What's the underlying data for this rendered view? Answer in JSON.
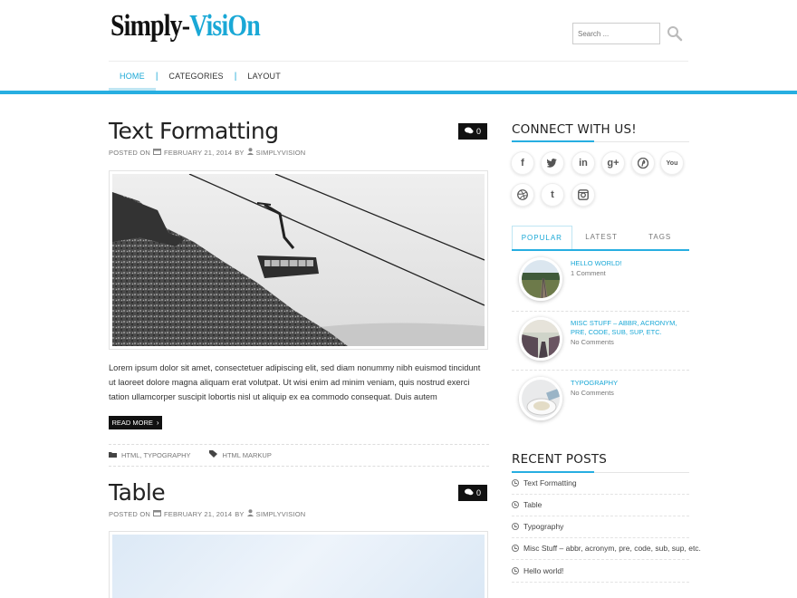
{
  "brand": {
    "part1": "Simply-",
    "part2": "VisiOn"
  },
  "search": {
    "placeholder": "Search ..."
  },
  "nav": {
    "items": [
      "HOME",
      "CATEGORIES",
      "LAYOUT"
    ],
    "separator": "|"
  },
  "colors": {
    "accent": "#27aee1",
    "link": "#1aa8d6",
    "dark": "#111111"
  },
  "posts": [
    {
      "title": "Text Formatting",
      "posted_on": "POSTED ON",
      "date": "FEBRUARY 21, 2014",
      "by": "BY",
      "author": "SIMPLYVISION",
      "comments": "0",
      "excerpt": "Lorem ipsum dolor sit amet, consectetuer adipiscing elit, sed diam nonummy nibh euismod tincidunt ut laoreet dolore magna aliquam erat volutpat. Ut wisi enim ad minim veniam, quis nostrud exerci tation ullamcorper suscipit lobortis nisl ut aliquip ex ea commodo consequat. Duis autem",
      "read_more": "READ MORE",
      "categories": "HTML, TYPOGRAPHY",
      "tags": "HTML MARKUP"
    },
    {
      "title": "Table",
      "posted_on": "POSTED ON",
      "date": "FEBRUARY 21, 2014",
      "by": "BY",
      "author": "SIMPLYVISION",
      "comments": "0"
    }
  ],
  "sidebar": {
    "connect_title": "CONNECT WITH US!",
    "social_icons": [
      "facebook-icon",
      "twitter-icon",
      "linkedin-icon",
      "google-plus-icon",
      "pinterest-icon",
      "youtube-icon",
      "dribbble-icon",
      "tumblr-icon",
      "instagram-icon"
    ],
    "social_glyphs": [
      "f",
      "🐦",
      "in",
      "g+",
      "℗",
      "You",
      "◎",
      "t",
      "▣"
    ],
    "tabs": [
      "POPULAR",
      "LATEST",
      "TAGS"
    ],
    "popular": [
      {
        "title": "HELLO WORLD!",
        "sub": "1 Comment"
      },
      {
        "title": "MISC STUFF – ABBR, ACRONYM, PRE, CODE, SUB, SUP, ETC.",
        "sub": "No Comments"
      },
      {
        "title": "TYPOGRAPHY",
        "sub": "No Comments"
      }
    ],
    "recent_title": "RECENT POSTS",
    "recent": [
      "Text Formatting",
      "Table",
      "Typography",
      "Misc Stuff – abbr, acronym, pre, code, sub, sup, etc.",
      "Hello world!"
    ]
  }
}
